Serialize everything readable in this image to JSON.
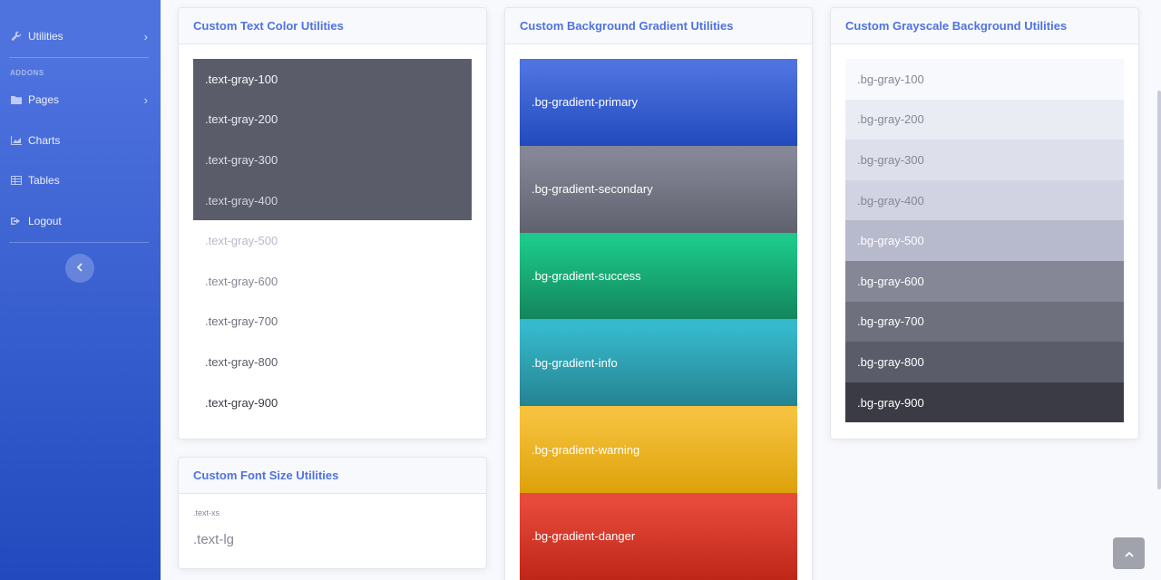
{
  "sidebar": {
    "utilities_label": "Utilities",
    "addons_heading": "ADDONS",
    "pages_label": "Pages",
    "charts_label": "Charts",
    "tables_label": "Tables",
    "logout_label": "Logout"
  },
  "text_color_card": {
    "title": "Custom Text Color Utilities",
    "items": [
      ".text-gray-100",
      ".text-gray-200",
      ".text-gray-300",
      ".text-gray-400",
      ".text-gray-500",
      ".text-gray-600",
      ".text-gray-700",
      ".text-gray-800",
      ".text-gray-900"
    ]
  },
  "font_size_card": {
    "title": "Custom Font Size Utilities",
    "xs": ".text-xs",
    "lg": ".text-lg"
  },
  "gradient_card": {
    "title": "Custom Background Gradient Utilities",
    "items": [
      ".bg-gradient-primary",
      ".bg-gradient-secondary",
      ".bg-gradient-success",
      ".bg-gradient-info",
      ".bg-gradient-warning",
      ".bg-gradient-danger"
    ]
  },
  "grayscale_card": {
    "title": "Custom Grayscale Background Utilities",
    "items": [
      ".bg-gray-100",
      ".bg-gray-200",
      ".bg-gray-300",
      ".bg-gray-400",
      ".bg-gray-500",
      ".bg-gray-600",
      ".bg-gray-700",
      ".bg-gray-800",
      ".bg-gray-900"
    ]
  },
  "colors": {
    "primary": "#4e73df",
    "text_gray_100": "#f8f9fc",
    "text_gray_200": "#eaecf4",
    "text_gray_300": "#dddfeb",
    "text_gray_400": "#d1d3e2",
    "text_gray_500": "#b7b9cc",
    "text_gray_600": "#858796",
    "text_gray_700": "#6e707e",
    "text_gray_800": "#5a5c69",
    "text_gray_900": "#3a3b45"
  }
}
